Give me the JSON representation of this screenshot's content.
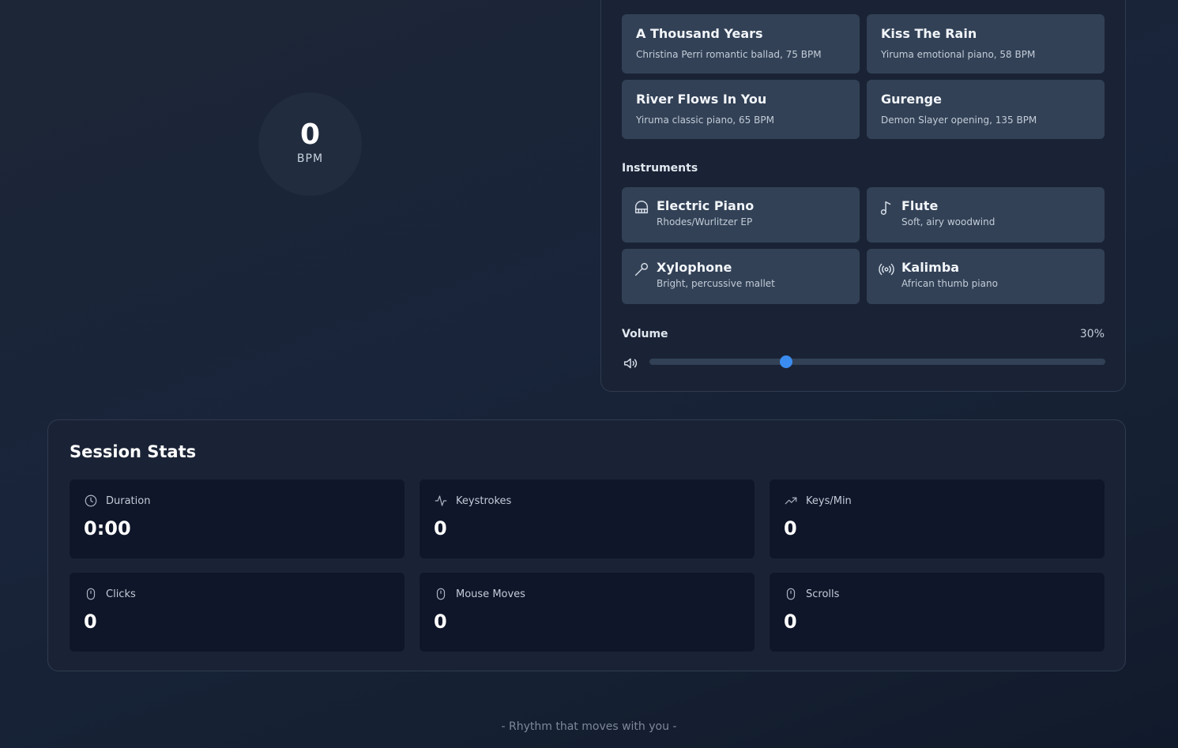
{
  "bpm": {
    "value": "0",
    "unit": "BPM"
  },
  "songs": [
    {
      "title": "A Thousand Years",
      "subtitle": "Christina Perri romantic ballad, 75 BPM"
    },
    {
      "title": "Kiss The Rain",
      "subtitle": "Yiruma emotional piano, 58 BPM"
    },
    {
      "title": "River Flows In You",
      "subtitle": "Yiruma classic piano, 65 BPM"
    },
    {
      "title": "Gurenge",
      "subtitle": "Demon Slayer opening, 135 BPM"
    }
  ],
  "instruments": {
    "label": "Instruments",
    "items": [
      {
        "name": "Electric Piano",
        "subtitle": "Rhodes/Wurlitzer EP",
        "icon": "piano-icon"
      },
      {
        "name": "Flute",
        "subtitle": "Soft, airy woodwind",
        "icon": "music-note-icon"
      },
      {
        "name": "Xylophone",
        "subtitle": "Bright, percussive mallet",
        "icon": "mallet-icon"
      },
      {
        "name": "Kalimba",
        "subtitle": "African thumb piano",
        "icon": "radio-waves-icon"
      }
    ]
  },
  "volume": {
    "label": "Volume",
    "display": "30%",
    "value": 0.3,
    "icon": "speaker-icon"
  },
  "session": {
    "title": "Session Stats",
    "stats": [
      {
        "label": "Duration",
        "value": "0:00",
        "icon": "clock-icon"
      },
      {
        "label": "Keystrokes",
        "value": "0",
        "icon": "activity-icon"
      },
      {
        "label": "Keys/Min",
        "value": "0",
        "icon": "trending-up-icon"
      },
      {
        "label": "Clicks",
        "value": "0",
        "icon": "mouse-icon"
      },
      {
        "label": "Mouse Moves",
        "value": "0",
        "icon": "mouse-icon"
      },
      {
        "label": "Scrolls",
        "value": "0",
        "icon": "mouse-icon"
      }
    ]
  },
  "footer": {
    "tagline": "- Rhythm that moves with you -"
  },
  "colors": {
    "accent": "#3b8cf0",
    "card": "#324156",
    "stat_card": "#0f1629"
  }
}
